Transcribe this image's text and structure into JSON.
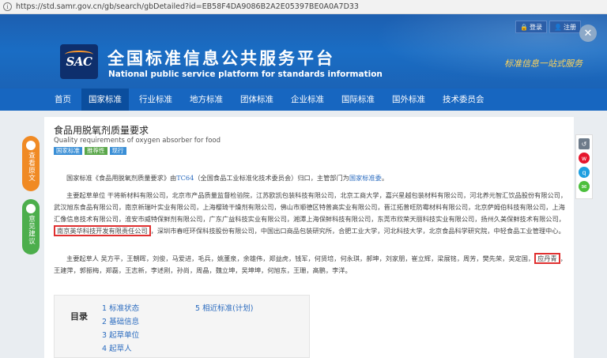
{
  "browser": {
    "url": "https://std.samr.gov.cn/gb/search/gbDetailed?id=EB58F4DA9086B2A2E05397BE0A0A7D33"
  },
  "header": {
    "logo_text": "SAC",
    "title": "全国标准信息公共服务平台",
    "subtitle": "National public service platform for standards information",
    "slogan": "标准信息一站式服务",
    "login_label": "登录",
    "register_label": "注册"
  },
  "nav": {
    "items": [
      "首页",
      "国家标准",
      "行业标准",
      "地方标准",
      "团体标准",
      "企业标准",
      "国际标准",
      "国外标准",
      "技术委员会"
    ],
    "active_index": 1
  },
  "side_left": {
    "original_text": "查看原文",
    "feedback": "意见建议"
  },
  "document": {
    "title": "食品用脱氧剂质量要求",
    "title_en": "Quality requirements of oxygen absorber for food",
    "tags": [
      "国家标准",
      "推荐性",
      "现行"
    ],
    "intro_a": "国家标准《食品用脱氧剂质量要求》由",
    "intro_tc": "TC64",
    "intro_b": "（全国食品工业标准化技术委员会）归口，主管部门为",
    "intro_dept": "国家标准委",
    "intro_c": "。",
    "drafting_units_a": "主要起草单位 干将新材料有限公司，北京市产品质量监督检验院，江苏欧凯包装科技有限公司，北京工商大学，嘉兴星越包装材料有限公司，河北养元智汇饮品股份有限公司，武汉旭东食品有限公司，南京新瑞叶实业有限公司，上海樱琦干燥剂有限公司，佛山市顺德区特普高实业有限公司，晋江拓普旺防霉材料有限公司，北京萨姆伯科技有限公司，上海汇像信息技术有限公司，淮安市威特保鲜剂有限公司，广东广益科技实业有限公司，湘潭上海保鲜科技有限公司，东莞市欣荣天丽科技实业有限公司，扬州久美保鲜技术有限公司，",
    "drafting_units_hl": "南京英华科技开发有限责任公司",
    "drafting_units_b": "，深圳市春旺环保科技股份有限公司，中国出口商品包装研究所，合肥工业大学，河北科技大学，北京食品科学研究院，中轻食品工业管理中心。",
    "drafters_a": "主要起草人 吴方平，王朝晖，刘俊，马爱进，毛兵，姚董泉，余雄伟，郑益虎，钱军，何贤培，何永琪，郝坤，刘家朋，崔立辉，梁展铭，周芳，樊先荣，吴定国，",
    "drafters_hl": "应丹青",
    "drafters_b": "，王建萍，郭振梅，郑磊，王志新，李述刚，孙尚，周晶，魏立坤，吴坤坤，何旭东，王珊，高鹏，李洋。"
  },
  "toc": {
    "label": "目录",
    "col1": [
      "1 标准状态",
      "2 基础信息",
      "3 起草单位",
      "4 起草人"
    ],
    "col2": [
      "5 相近标准(计划)"
    ]
  }
}
